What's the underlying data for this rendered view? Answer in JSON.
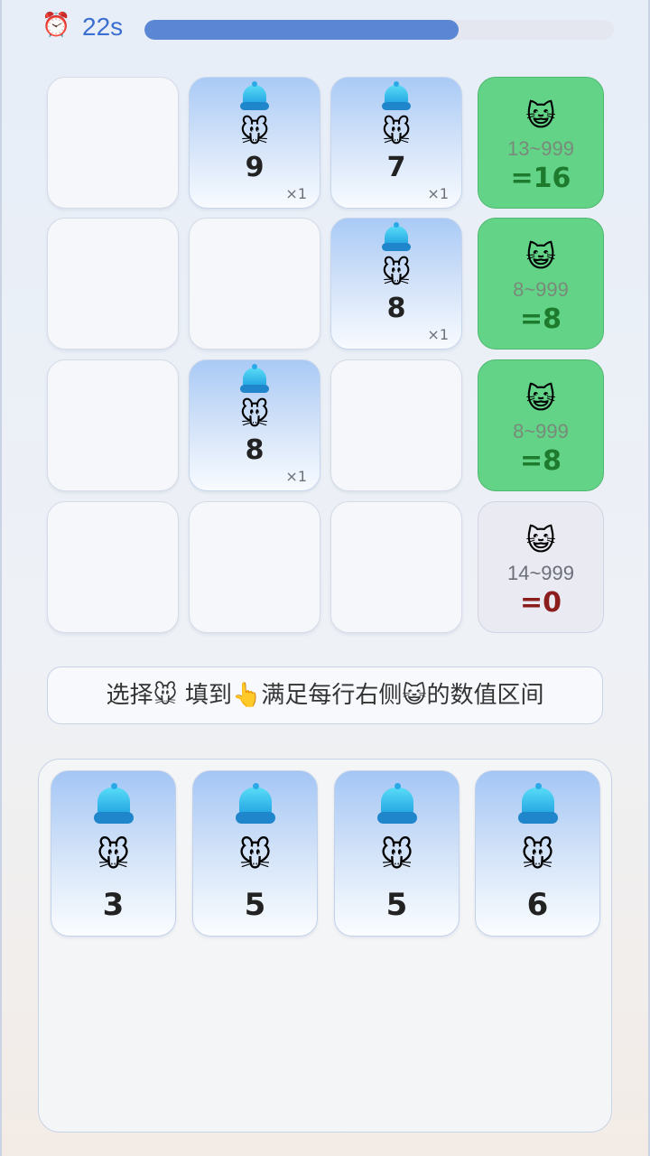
{
  "timer": {
    "label": "22s",
    "progress": 0.67,
    "icon": "alarm-clock-icon"
  },
  "board": {
    "rows": [
      {
        "cells": [
          null,
          {
            "value": "9",
            "mult": "×1"
          },
          {
            "value": "7",
            "mult": "×1"
          }
        ],
        "target": {
          "icon": "cat-icon",
          "range": "13~999",
          "sum": "=16",
          "satisfied": true
        }
      },
      {
        "cells": [
          null,
          null,
          {
            "value": "8",
            "mult": "×1"
          }
        ],
        "target": {
          "icon": "cat-icon",
          "range": "8~999",
          "sum": "=8",
          "satisfied": true
        }
      },
      {
        "cells": [
          null,
          {
            "value": "8",
            "mult": "×1"
          },
          null
        ],
        "target": {
          "icon": "cat-icon",
          "range": "8~999",
          "sum": "=8",
          "satisfied": true
        }
      },
      {
        "cells": [
          null,
          null,
          null
        ],
        "target": {
          "icon": "cat-icon",
          "range": "14~999",
          "sum": "=0",
          "satisfied": false
        }
      }
    ]
  },
  "instruction": {
    "part1": "选择",
    "part2": "填到",
    "part3": "满足每行右侧",
    "part4": "的数值区间"
  },
  "tray": {
    "pieces": [
      {
        "value": "3"
      },
      {
        "value": "5"
      },
      {
        "value": "5"
      },
      {
        "value": "6"
      }
    ]
  },
  "colors": {
    "ok": "#63d487",
    "not_ok": "#eaeaf3",
    "accent": "#5a86d3",
    "ok_sum": "#1e7a2d",
    "bad_sum": "#8b1d1d"
  }
}
